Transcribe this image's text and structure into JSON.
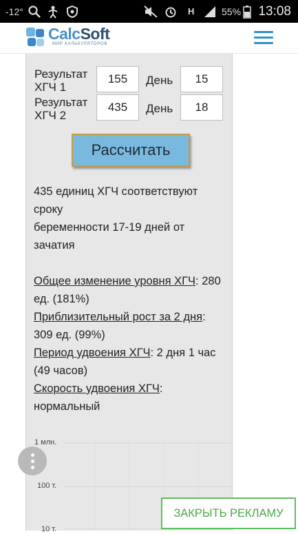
{
  "status_bar": {
    "temperature": "-12°",
    "battery": "55%",
    "network": "H",
    "clock": "13:08"
  },
  "header": {
    "logo_part1": "Calc",
    "logo_part2": "Soft",
    "logo_subtitle": "МИР КАЛЬКУЛЯТОРОВ"
  },
  "form": {
    "result1_label_line1": "Результат",
    "result1_label_line2": "ХГЧ 1",
    "result1_value": "155",
    "day1_label": "День",
    "day1_value": "15",
    "result2_label_line1": "Результат",
    "result2_label_line2": "ХГЧ 2",
    "result2_value": "435",
    "day2_label": "День",
    "day2_value": "18",
    "calculate_label": "Рассчитать"
  },
  "result": {
    "line1": "435 единиц ХГЧ соответствуют",
    "line2": "сроку",
    "line3": "беременности 17-19 дней от",
    "line4": "зачатия",
    "total_change_label": "Общее изменение уровня ХГЧ",
    "total_change_value_a": ": 280",
    "total_change_value_b": "ед. (181%)",
    "growth_label": "Приблизительный рост за 2 дня",
    "growth_value_a": ":",
    "growth_value_b": "309 ед. (99%)",
    "doubling_period_label": "Период удвоения ХГЧ",
    "doubling_period_value_a": ": 2 дня 1 час",
    "doubling_period_value_b": "(49 часов)",
    "doubling_speed_label": "Скорость удвоения ХГЧ",
    "doubling_speed_value_a": ":",
    "doubling_speed_value_b": "нормальный"
  },
  "chart_data": {
    "type": "line",
    "yticks": [
      "1 млн.",
      "100 т.",
      "10 т."
    ],
    "scale": "log"
  },
  "ad": {
    "close_label": "ЗАКРЫТЬ РЕКЛАМУ"
  },
  "colors": {
    "accent": "#2f8fd0",
    "button": "#7ab9de",
    "ad_green": "#4aa84a"
  }
}
